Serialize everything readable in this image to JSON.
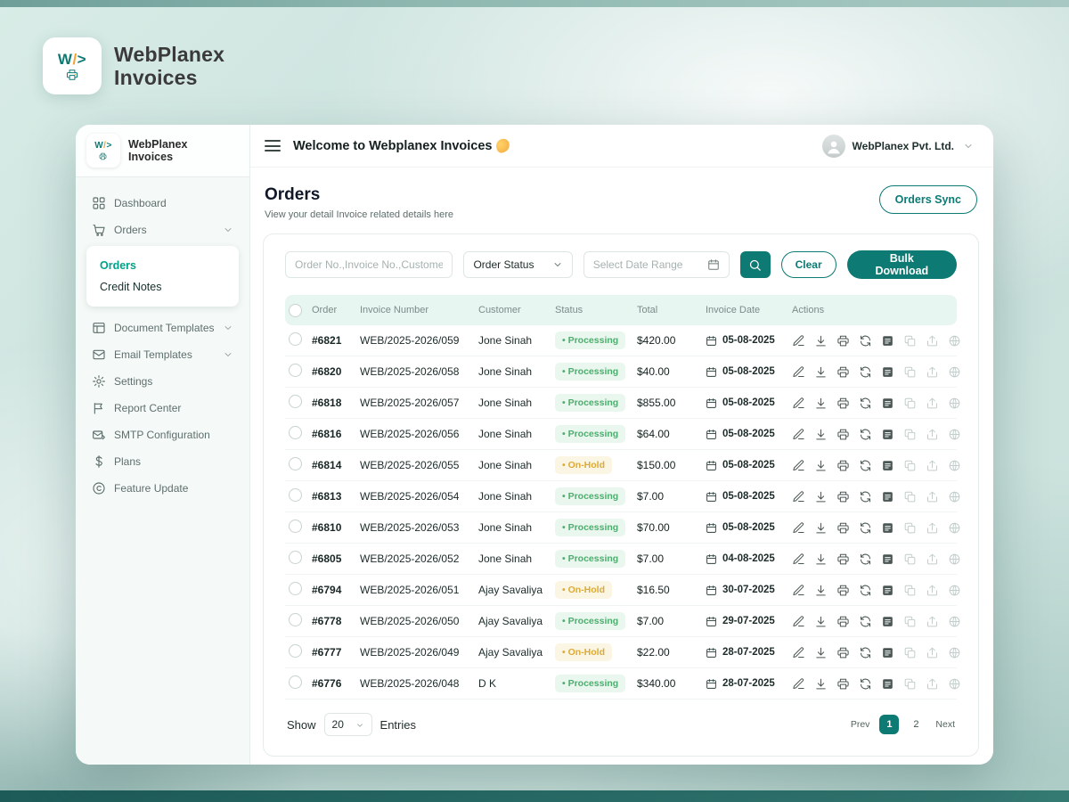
{
  "brand": {
    "logo_w": "W",
    "logo_slash": "/",
    "logo_gt": ">",
    "name_line1": "WebPlanex",
    "name_line2": "Invoices"
  },
  "topbar": {
    "welcome": "Welcome to Webplanex Invoices",
    "account_name": "WebPlanex Pvt. Ltd."
  },
  "sidebar": {
    "items": [
      {
        "label": "Dashboard"
      },
      {
        "label": "Orders"
      },
      {
        "label": "Document Templates"
      },
      {
        "label": "Email Templates"
      },
      {
        "label": "Settings"
      },
      {
        "label": "Report Center"
      },
      {
        "label": "SMTP Configuration"
      },
      {
        "label": "Plans"
      },
      {
        "label": "Feature Update"
      }
    ],
    "orders_submenu": [
      {
        "label": "Orders",
        "active": true
      },
      {
        "label": "Credit Notes",
        "active": false
      }
    ]
  },
  "page": {
    "title": "Orders",
    "subtitle": "View your detail Invoice related details here",
    "orders_sync_button": "Orders Sync"
  },
  "filters": {
    "search_placeholder": "Order No.,Invoice No.,Customer",
    "status_dropdown_value": "Order Status",
    "date_range_placeholder": "Select Date Range",
    "clear_button": "Clear",
    "bulk_download_button": "Bulk Download"
  },
  "table": {
    "columns": [
      "Order",
      "Invoice Number",
      "Customer",
      "Status",
      "Total",
      "Invoice Date",
      "Actions"
    ],
    "action_icons": [
      "edit",
      "download",
      "print",
      "refresh",
      "invoice",
      "duplicate",
      "share",
      "badge"
    ],
    "rows": [
      {
        "order": "#6821",
        "invoice_number": "WEB/2025-2026/059",
        "customer": "Jone Sinah",
        "status": "Processing",
        "total": "$420.00",
        "invoice_date": "05-08-2025"
      },
      {
        "order": "#6820",
        "invoice_number": "WEB/2025-2026/058",
        "customer": "Jone Sinah",
        "status": "Processing",
        "total": "$40.00",
        "invoice_date": "05-08-2025"
      },
      {
        "order": "#6818",
        "invoice_number": "WEB/2025-2026/057",
        "customer": "Jone Sinah",
        "status": "Processing",
        "total": "$855.00",
        "invoice_date": "05-08-2025"
      },
      {
        "order": "#6816",
        "invoice_number": "WEB/2025-2026/056",
        "customer": "Jone Sinah",
        "status": "Processing",
        "total": "$64.00",
        "invoice_date": "05-08-2025"
      },
      {
        "order": "#6814",
        "invoice_number": "WEB/2025-2026/055",
        "customer": "Jone Sinah",
        "status": "On-Hold",
        "total": "$150.00",
        "invoice_date": "05-08-2025"
      },
      {
        "order": "#6813",
        "invoice_number": "WEB/2025-2026/054",
        "customer": "Jone Sinah",
        "status": "Processing",
        "total": "$7.00",
        "invoice_date": "05-08-2025"
      },
      {
        "order": "#6810",
        "invoice_number": "WEB/2025-2026/053",
        "customer": "Jone Sinah",
        "status": "Processing",
        "total": "$70.00",
        "invoice_date": "05-08-2025"
      },
      {
        "order": "#6805",
        "invoice_number": "WEB/2025-2026/052",
        "customer": "Jone Sinah",
        "status": "Processing",
        "total": "$7.00",
        "invoice_date": "04-08-2025"
      },
      {
        "order": "#6794",
        "invoice_number": "WEB/2025-2026/051",
        "customer": "Ajay Savaliya",
        "status": "On-Hold",
        "total": "$16.50",
        "invoice_date": "30-07-2025"
      },
      {
        "order": "#6778",
        "invoice_number": "WEB/2025-2026/050",
        "customer": "Ajay Savaliya",
        "status": "Processing",
        "total": "$7.00",
        "invoice_date": "29-07-2025"
      },
      {
        "order": "#6777",
        "invoice_number": "WEB/2025-2026/049",
        "customer": "Ajay Savaliya",
        "status": "On-Hold",
        "total": "$22.00",
        "invoice_date": "28-07-2025"
      },
      {
        "order": "#6776",
        "invoice_number": "WEB/2025-2026/048",
        "customer": "D K",
        "status": "Processing",
        "total": "$340.00",
        "invoice_date": "28-07-2025"
      }
    ]
  },
  "footer": {
    "show_label": "Show",
    "page_size": "20",
    "entries_label": "Entries",
    "prev_label": "Prev",
    "pages": [
      "1",
      "2"
    ],
    "active_page": "1",
    "next_label": "Next"
  },
  "colors": {
    "accent_teal": "#0d7a74",
    "status_processing": "#4cae6e",
    "status_on_hold": "#dcab35"
  }
}
